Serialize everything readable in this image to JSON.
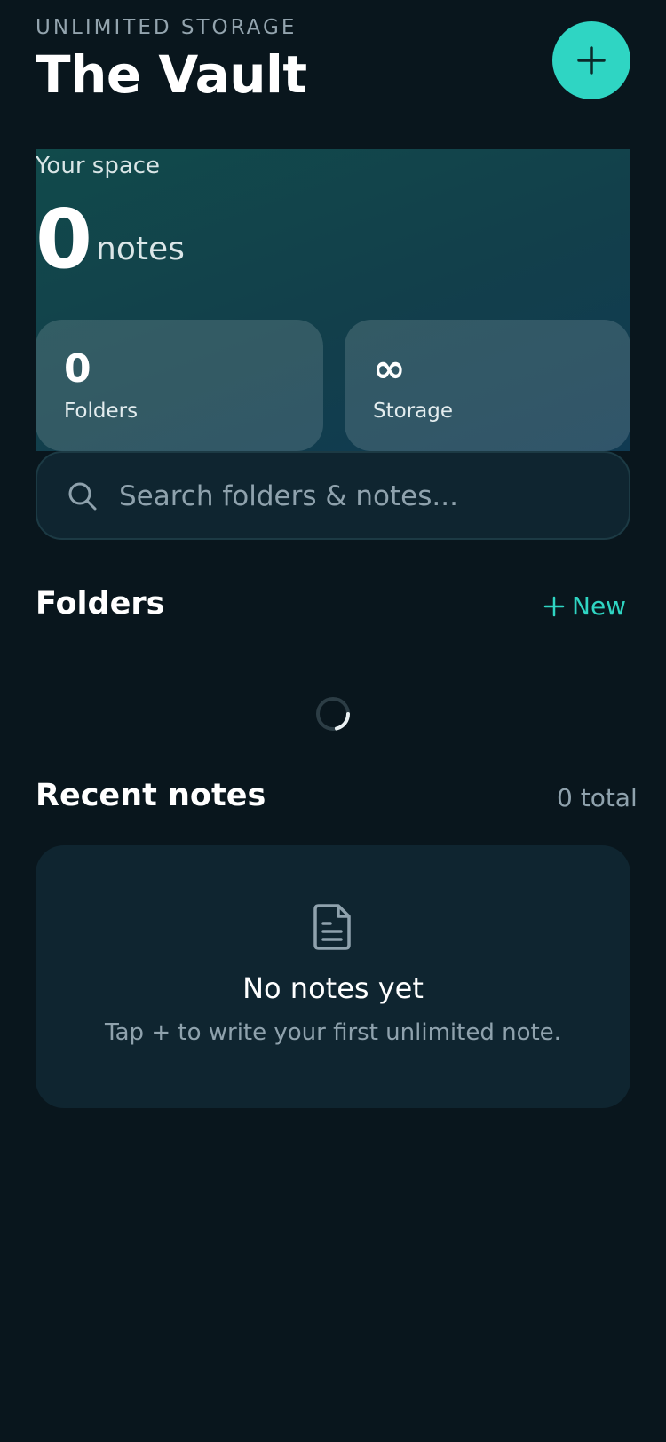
{
  "header": {
    "eyebrow": "UNLIMITED STORAGE",
    "title": "The Vault",
    "add_label": "+"
  },
  "space": {
    "label": "Your space",
    "count": "0",
    "unit": "notes",
    "stats": [
      {
        "value": "0",
        "label": "Folders"
      },
      {
        "value": "∞",
        "label": "Storage"
      }
    ]
  },
  "search": {
    "placeholder": "Search folders & notes..."
  },
  "folders": {
    "title": "Folders",
    "new_label": "New"
  },
  "recent": {
    "title": "Recent notes",
    "total": "0 total",
    "empty_title": "No notes yet",
    "empty_subtitle": "Tap + to write your first unlimited note."
  },
  "colors": {
    "accent": "#2fd5c3",
    "background": "#09161d",
    "card": "#0f2530",
    "muted_text": "#8fa2ad"
  },
  "icons": [
    "plus-icon",
    "search-icon",
    "loading-spinner",
    "document-icon"
  ]
}
